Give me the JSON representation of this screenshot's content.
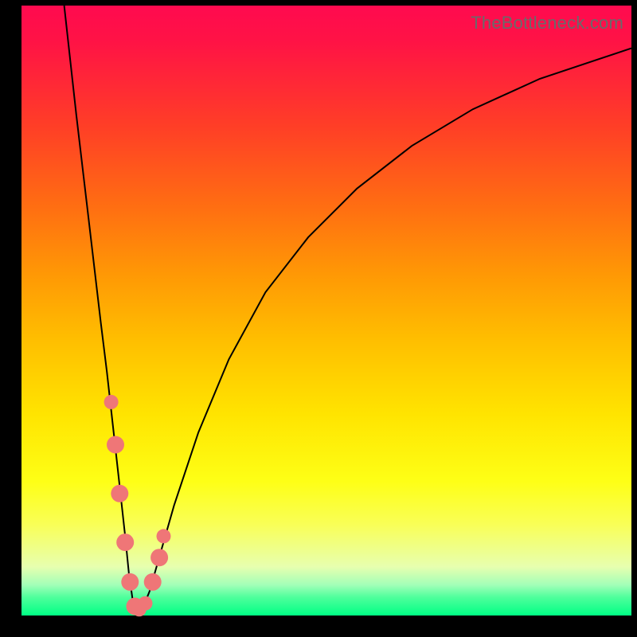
{
  "watermark": "TheBottleneck.com",
  "colors": {
    "frame": "#000000",
    "dot": "#ef7677",
    "curve": "#000000",
    "gradient_top": "#ff0a4f",
    "gradient_bottom": "#00ff85"
  },
  "chart_data": {
    "type": "line",
    "title": "",
    "xlabel": "",
    "ylabel": "",
    "xlim": [
      0,
      100
    ],
    "ylim": [
      0,
      100
    ],
    "x": [
      7,
      9,
      11,
      13,
      14,
      15,
      16,
      17,
      17.6,
      18.3,
      19,
      20,
      21,
      23,
      25,
      29,
      34,
      40,
      47,
      55,
      64,
      74,
      85,
      100
    ],
    "values": [
      100,
      82,
      65,
      48,
      40,
      31,
      22,
      13,
      7,
      2,
      0.5,
      1.5,
      4,
      11,
      18,
      30,
      42,
      53,
      62,
      70,
      77,
      83,
      88,
      93
    ],
    "markers": {
      "x": [
        14.7,
        15.4,
        16.1,
        17.0,
        17.8,
        18.6,
        19.3,
        20.3,
        21.5,
        22.6,
        23.3
      ],
      "y": [
        35,
        28,
        20,
        12,
        5.5,
        1.5,
        1,
        2,
        5.5,
        9.5,
        13
      ],
      "radius": [
        9,
        11,
        11,
        11,
        11,
        11,
        9,
        9,
        11,
        11,
        9
      ]
    }
  }
}
